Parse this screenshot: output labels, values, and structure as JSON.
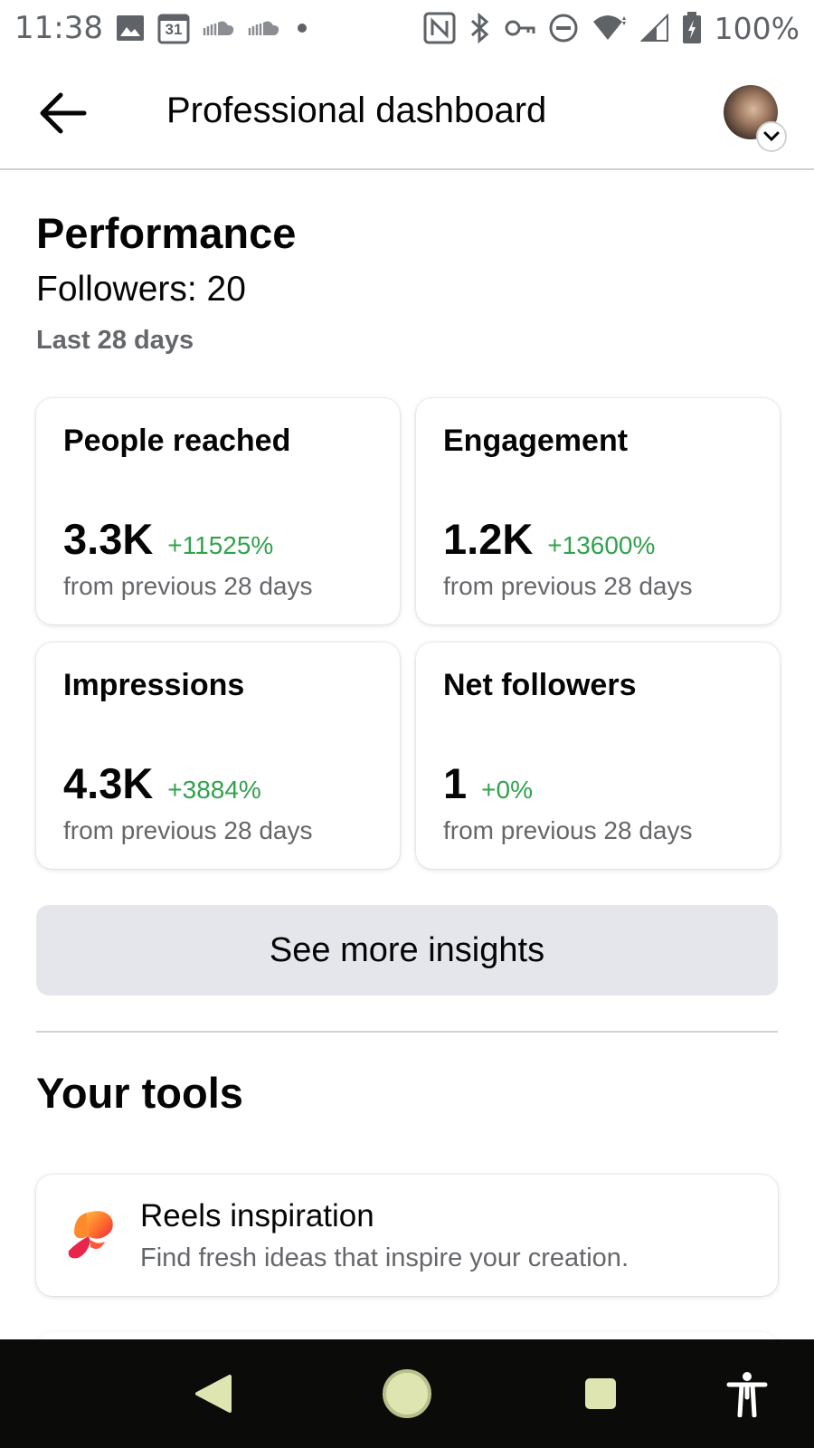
{
  "status_bar": {
    "time": "11:38",
    "calendar_day": "31",
    "battery_percent": "100%"
  },
  "header": {
    "title": "Professional dashboard"
  },
  "performance": {
    "title": "Performance",
    "followers": "Followers: 20",
    "period": "Last 28 days",
    "cards": [
      {
        "title": "People reached",
        "value": "3.3K",
        "change": "+11525%",
        "sub": "from previous 28 days"
      },
      {
        "title": "Engagement",
        "value": "1.2K",
        "change": "+13600%",
        "sub": "from previous 28 days"
      },
      {
        "title": "Impressions",
        "value": "4.3K",
        "change": "+3884%",
        "sub": "from previous 28 days"
      },
      {
        "title": "Net followers",
        "value": "1",
        "change": "+0%",
        "sub": "from previous 28 days"
      }
    ],
    "insights_button": "See more insights"
  },
  "tools": {
    "title": "Your tools",
    "items": [
      {
        "title": "Reels inspiration",
        "description": "Find fresh ideas that inspire your creation.",
        "icon": "butterfly-icon"
      }
    ]
  },
  "colors": {
    "positive_change": "#31a24c",
    "secondary_text": "#65676b",
    "button_bg": "#e4e6eb",
    "nav_bar_bg": "#0b0b09",
    "nav_button_fill": "#dfe5b0"
  }
}
